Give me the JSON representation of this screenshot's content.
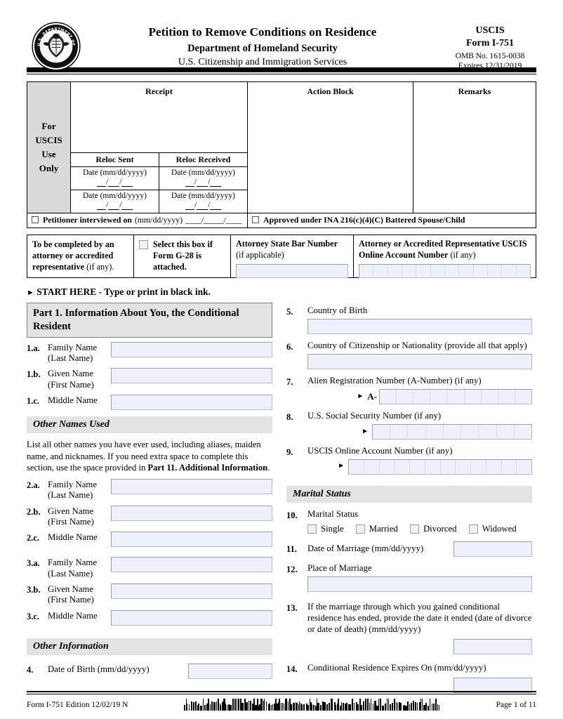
{
  "header": {
    "seal_alt": "Department of Homeland Security seal",
    "title": "Petition to Remove Conditions on Residence",
    "subtitle1": "Department of Homeland Security",
    "subtitle2": "U.S. Citizenship and Immigration Services",
    "agency": "USCIS",
    "form_number": "Form I-751",
    "omb": "OMB No. 1615-0038",
    "expires": "Expires 12/31/2019"
  },
  "uscis_block": {
    "side_label_lines": [
      "For",
      "USCIS",
      "Use",
      "Only"
    ],
    "receipt_label": "Receipt",
    "action_block_label": "Action Block",
    "remarks_label": "Remarks",
    "reloc_sent_label": "Reloc Sent",
    "reloc_received_label": "Reloc Received",
    "date_format": "Date (mm/dd/yyyy)",
    "interview_label": "Petitioner interviewed on",
    "interview_format": "(mm/dd/yyyy)",
    "approved_label": "Approved under INA 216(c)(4)(C) Battered Spouse/Child"
  },
  "attorney": {
    "cell1_bold": "To be completed by an attorney or accredited representative",
    "cell1_regular": " (if any).",
    "checkbox_label": "Select this box if Form G-28 is attached.",
    "bar_number_title": "Attorney State Bar Number",
    "bar_number_note": "(if applicable)",
    "online_account_title": "Attorney or Accredited Representative USCIS Online Account Number",
    "online_account_note": " (if any)"
  },
  "start_here": "START HERE - Type or print in black ink.",
  "part1": {
    "heading": "Part 1.  Information About You, the Conditional Resident",
    "items": [
      {
        "num": "1.a.",
        "label": "Family Name\n(Last Name)"
      },
      {
        "num": "1.b.",
        "label": "Given Name\n(First Name)"
      },
      {
        "num": "1.c.",
        "label": "Middle Name"
      }
    ]
  },
  "other_names": {
    "heading": "Other Names Used",
    "instructions_p1": "List all other names you have ever used, including aliases, maiden name, and nicknames.  If you need extra space to complete this section, use the space provided in ",
    "instructions_bold": "Part 11. Additional Information",
    "instructions_p2": ".",
    "items": [
      {
        "num": "2.a.",
        "label": "Family Name\n(Last Name)"
      },
      {
        "num": "2.b.",
        "label": "Given Name\n(First Name)"
      },
      {
        "num": "2.c.",
        "label": "Middle Name"
      },
      {
        "num": "3.a.",
        "label": "Family Name\n(Last Name)"
      },
      {
        "num": "3.b.",
        "label": "Given Name\n(First Name)"
      },
      {
        "num": "3.c.",
        "label": "Middle Name"
      }
    ]
  },
  "other_information": {
    "heading": "Other Information",
    "item4_num": "4.",
    "item4_label": "Date of Birth (mm/dd/yyyy)"
  },
  "right_column": {
    "item5": {
      "num": "5.",
      "label": "Country of Birth"
    },
    "item6": {
      "num": "6.",
      "label": "Country of Citizenship or Nationality (provide all that apply)"
    },
    "item7": {
      "num": "7.",
      "label": "Alien Registration Number (A-Number) (if any)",
      "prefix": "A-",
      "segments": 9
    },
    "item8": {
      "num": "8.",
      "label": "U.S. Social Security Number (if any)",
      "segments": 9
    },
    "item9": {
      "num": "9.",
      "label": "USCIS Online Account Number (if any)",
      "segments": 12
    }
  },
  "marital_status": {
    "heading": "Marital Status",
    "item10_num": "10.",
    "item10_label": "Marital Status",
    "options": [
      "Single",
      "Married",
      "Divorced",
      "Widowed"
    ],
    "item11_num": "11.",
    "item11_label": "Date of Marriage (mm/dd/yyyy)",
    "item12_num": "12.",
    "item12_label": "Place of Marriage",
    "item13_num": "13.",
    "item13_label": "If the marriage through which you gained conditional residence has ended, provide the date it ended (date of divorce or date of death) (mm/dd/yyyy)",
    "item14_num": "14.",
    "item14_label": "Conditional Residence Expires On (mm/dd/yyyy)"
  },
  "footer": {
    "left": "Form I-751   Edition   12/02/19  N",
    "right": "Page 1 of 11"
  },
  "colors": {
    "field_fill": "#eef0fa",
    "field_border": "#9d9dab",
    "section_header_fill": "#e3e3e3",
    "uscis_side_fill": "#d9d9d9"
  }
}
